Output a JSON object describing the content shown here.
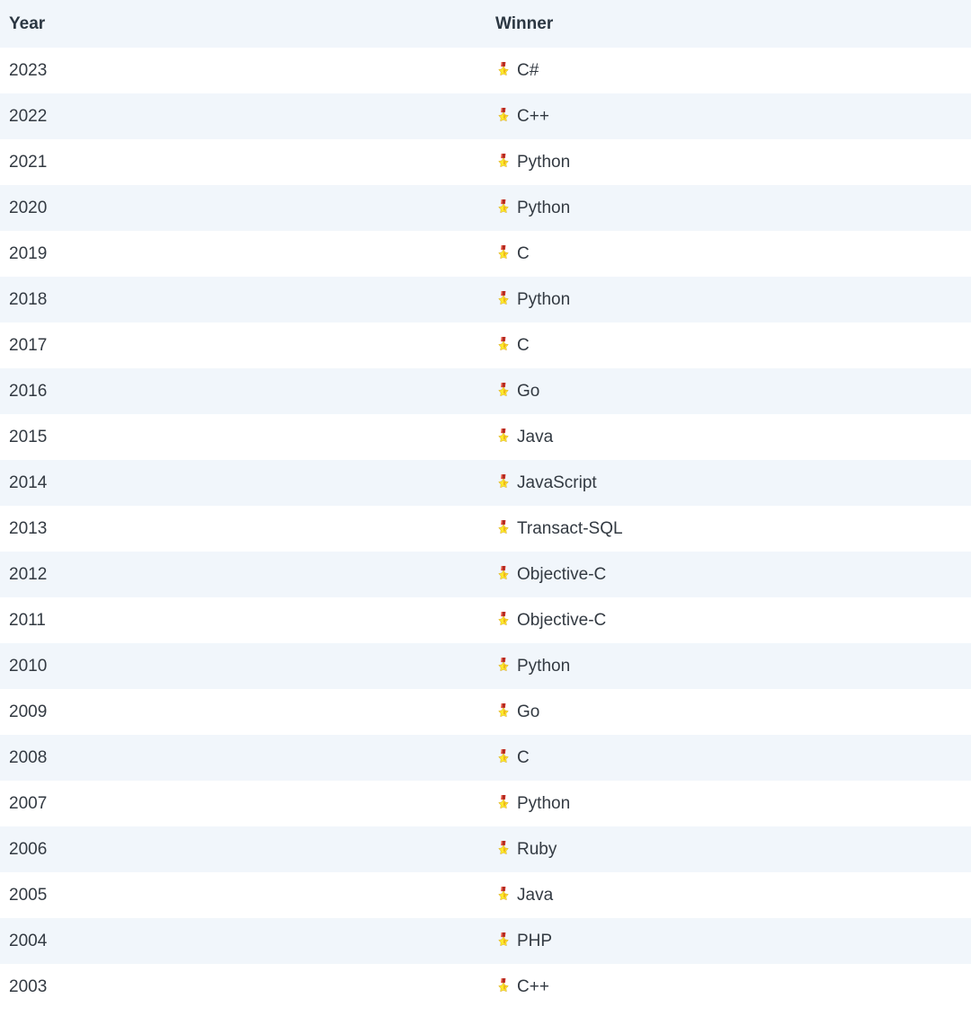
{
  "table": {
    "columns": [
      {
        "key": "year",
        "label": "Year"
      },
      {
        "key": "winner",
        "label": "Winner"
      }
    ],
    "winner_icon": "sports-medal-icon",
    "colors": {
      "stripe": "#f1f6fb",
      "row": "#ffffff",
      "header_text": "#2c3742",
      "body_text": "#333a42",
      "medal_ribbon": "#d22f27",
      "medal_star": "#fcea2b"
    },
    "rows": [
      {
        "year": "2023",
        "winner": "C#"
      },
      {
        "year": "2022",
        "winner": "C++"
      },
      {
        "year": "2021",
        "winner": "Python"
      },
      {
        "year": "2020",
        "winner": "Python"
      },
      {
        "year": "2019",
        "winner": "C"
      },
      {
        "year": "2018",
        "winner": "Python"
      },
      {
        "year": "2017",
        "winner": "C"
      },
      {
        "year": "2016",
        "winner": "Go"
      },
      {
        "year": "2015",
        "winner": "Java"
      },
      {
        "year": "2014",
        "winner": "JavaScript"
      },
      {
        "year": "2013",
        "winner": "Transact-SQL"
      },
      {
        "year": "2012",
        "winner": "Objective-C"
      },
      {
        "year": "2011",
        "winner": "Objective-C"
      },
      {
        "year": "2010",
        "winner": "Python"
      },
      {
        "year": "2009",
        "winner": "Go"
      },
      {
        "year": "2008",
        "winner": "C"
      },
      {
        "year": "2007",
        "winner": "Python"
      },
      {
        "year": "2006",
        "winner": "Ruby"
      },
      {
        "year": "2005",
        "winner": "Java"
      },
      {
        "year": "2004",
        "winner": "PHP"
      },
      {
        "year": "2003",
        "winner": "C++"
      }
    ]
  }
}
